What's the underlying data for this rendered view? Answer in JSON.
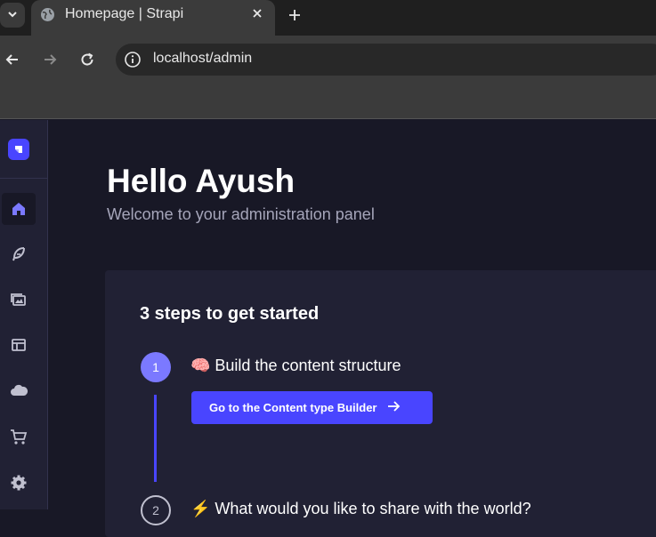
{
  "browser": {
    "tab": {
      "title": "Homepage | Strapi"
    },
    "url": "localhost/admin"
  },
  "app": {
    "sidebar": {
      "items": [
        {
          "icon": "home-icon",
          "active": true
        },
        {
          "icon": "feather-icon",
          "active": false
        },
        {
          "icon": "images-icon",
          "active": false
        },
        {
          "icon": "layout-icon",
          "active": false
        },
        {
          "icon": "cloud-icon",
          "active": false
        },
        {
          "icon": "cart-icon",
          "active": false
        },
        {
          "icon": "gear-icon",
          "active": false
        }
      ]
    },
    "header": {
      "title": "Hello Ayush",
      "subtitle": "Welcome to your administration panel"
    },
    "steps_card": {
      "title": "3 steps to get started",
      "step1": {
        "number": "1",
        "title": "🧠 Build the content structure",
        "button": "Go to the Content type Builder"
      },
      "step2": {
        "number": "2",
        "title": "⚡ What would you like to share with the world?"
      }
    }
  },
  "colors": {
    "accent": "#4945ff",
    "step_done": "#7b79ff",
    "background": "#181826",
    "panel": "#212134"
  }
}
